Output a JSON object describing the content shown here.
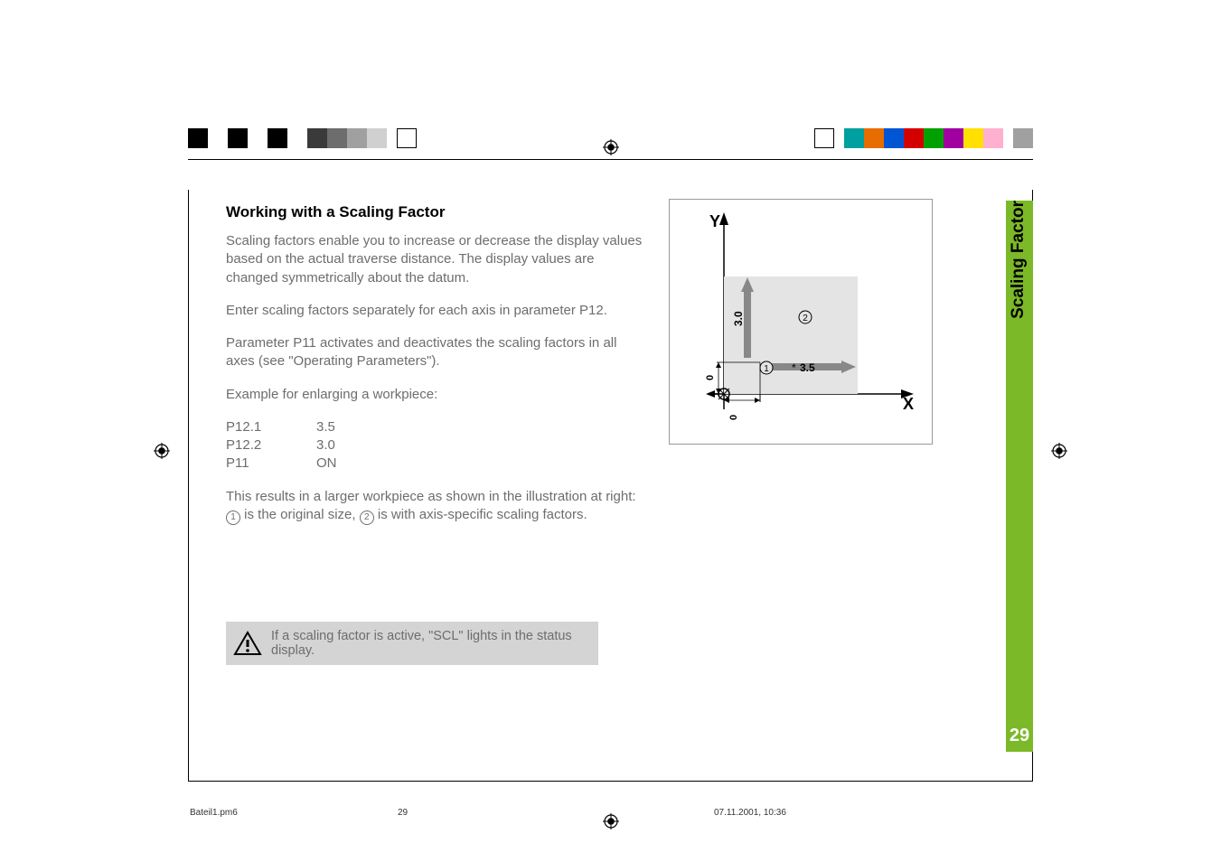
{
  "heading": "Working with a Scaling Factor",
  "para1": "Scaling factors enable you to increase or decrease the display values based on the actual traverse distance. The display values are changed symmetrically about the datum.",
  "para2": "Enter scaling factors separately for each axis in parameter P12.",
  "para3": "Parameter P11 activates and deactivates the scaling factors in all axes (see \"Operating Parameters\").",
  "para4": "Example for enlarging a workpiece:",
  "params": [
    {
      "key": "P12.1",
      "val": "3.5"
    },
    {
      "key": "P12.2",
      "val": "3.0"
    },
    {
      "key": "P11",
      "val": "ON"
    }
  ],
  "para5_prefix": "This results in a larger workpiece as shown in the illustration at right:",
  "para5_circ1": "1",
  "para5_mid1": " is the original size, ",
  "para5_circ2": "2",
  "para5_mid2": " is with axis-specific scaling factors.",
  "note_text": "If a scaling factor is active, \"SCL\" lights in the status display.",
  "sidebar_title": "Scaling Factor",
  "page_number": "29",
  "figure": {
    "y_axis": "Y",
    "x_axis": "X",
    "val_30": "3.0",
    "val_35": "3.5",
    "zero": "0",
    "marker1": "1",
    "marker2": "2"
  },
  "footer": {
    "filename": "Bateil1.pm6",
    "pageno": "29",
    "timestamp": "07.11.2001, 10:36"
  },
  "chart_data": {
    "type": "area",
    "title": "Scaling factor workpiece illustration",
    "xlabel": "X",
    "ylabel": "Y",
    "xlim": [
      0,
      3.5
    ],
    "ylim": [
      0,
      3.0
    ],
    "series": [
      {
        "name": "1 original size",
        "box": {
          "x0": 0,
          "y0": 0,
          "x1": 1.0,
          "y1": 1.0
        }
      },
      {
        "name": "2 axis-specific scaling",
        "box": {
          "x0": 0,
          "y0": 0,
          "x1": 3.5,
          "y1": 3.0
        }
      }
    ],
    "annotations": [
      {
        "text": "3.0",
        "axis": "Y",
        "value": 3.0
      },
      {
        "text": "3.5",
        "axis": "X",
        "value": 3.5
      },
      {
        "text": "0",
        "axis": "X",
        "value": 0
      },
      {
        "text": "0",
        "axis": "Y",
        "value": 0
      }
    ]
  }
}
